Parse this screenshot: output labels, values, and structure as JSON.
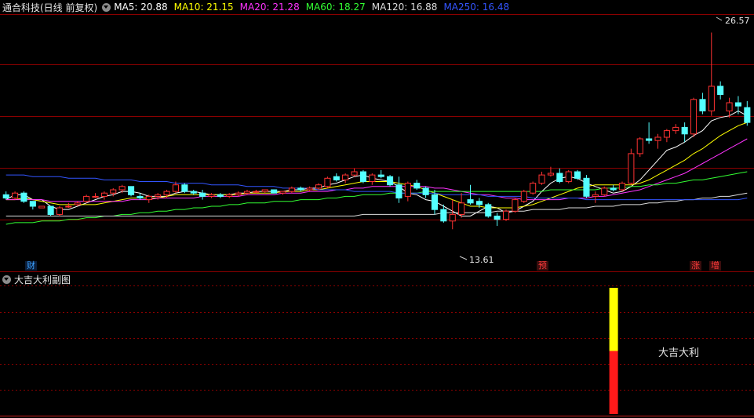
{
  "header": {
    "title": "通合科技(日线 前复权)",
    "ma": [
      {
        "label": "MA5: 20.88",
        "color": "#ffffff"
      },
      {
        "label": "MA10: 21.15",
        "color": "#ffff00"
      },
      {
        "label": "MA20: 21.28",
        "color": "#ff33ff"
      },
      {
        "label": "MA60: 18.27",
        "color": "#33ff33"
      },
      {
        "label": "MA120: 16.88",
        "color": "#dddddd"
      },
      {
        "label": "MA250: 16.48",
        "color": "#3355ff"
      }
    ]
  },
  "main_chart": {
    "high_label": "26.57",
    "low_label": "13.61",
    "markers": [
      {
        "text": "财"
      },
      {
        "text": "预"
      },
      {
        "text": "涨"
      },
      {
        "text": "增"
      }
    ]
  },
  "sub_panel": {
    "title": "大吉大利副图",
    "signal_label": "大吉大利"
  },
  "colors": {
    "up": "#ff3232",
    "down": "#54ffff",
    "grid": "#8b0000"
  },
  "chart_data": {
    "type": "candlestick",
    "ylim": [
      12.8,
      27.5
    ],
    "candles": [
      [
        16.7,
        16.9,
        16.4,
        16.5
      ],
      [
        16.5,
        16.9,
        16.4,
        16.8
      ],
      [
        16.8,
        16.9,
        16.2,
        16.3
      ],
      [
        16.3,
        16.3,
        15.8,
        16.0
      ],
      [
        15.9,
        16.0,
        15.9,
        16.0
      ],
      [
        16.0,
        16.0,
        15.4,
        15.5
      ],
      [
        15.5,
        16.0,
        15.4,
        15.9
      ],
      [
        16.0,
        16.2,
        15.9,
        16.0
      ],
      [
        16.1,
        16.3,
        16.0,
        16.2
      ],
      [
        16.3,
        16.7,
        16.2,
        16.6
      ],
      [
        16.6,
        16.8,
        16.5,
        16.6
      ],
      [
        16.6,
        16.9,
        16.4,
        16.8
      ],
      [
        16.8,
        17.1,
        16.6,
        17.0
      ],
      [
        17.0,
        17.3,
        16.8,
        17.2
      ],
      [
        17.2,
        17.0,
        16.6,
        16.7
      ],
      [
        16.6,
        16.8,
        16.4,
        16.5
      ],
      [
        16.4,
        16.7,
        16.2,
        16.6
      ],
      [
        16.6,
        16.8,
        16.4,
        16.7
      ],
      [
        16.7,
        17.0,
        16.5,
        16.9
      ],
      [
        16.9,
        17.5,
        16.8,
        17.3
      ],
      [
        17.3,
        17.4,
        16.8,
        16.9
      ],
      [
        16.9,
        17.0,
        16.7,
        16.8
      ],
      [
        16.8,
        17.0,
        16.4,
        16.6
      ],
      [
        16.6,
        16.8,
        16.5,
        16.7
      ],
      [
        16.7,
        16.8,
        16.5,
        16.6
      ],
      [
        16.6,
        16.8,
        16.5,
        16.7
      ],
      [
        16.7,
        16.9,
        16.6,
        16.8
      ],
      [
        16.8,
        17.0,
        16.7,
        16.9
      ],
      [
        16.9,
        17.0,
        16.8,
        16.9
      ],
      [
        16.9,
        17.0,
        16.8,
        17.0
      ],
      [
        17.0,
        17.0,
        16.8,
        16.8
      ],
      [
        16.8,
        16.9,
        16.7,
        16.9
      ],
      [
        16.9,
        17.2,
        16.8,
        17.1
      ],
      [
        17.1,
        17.2,
        16.9,
        17.0
      ],
      [
        17.0,
        17.2,
        16.9,
        17.1
      ],
      [
        17.1,
        17.4,
        17.0,
        17.3
      ],
      [
        17.2,
        17.8,
        17.1,
        17.7
      ],
      [
        17.8,
        18.0,
        17.5,
        17.6
      ],
      [
        17.6,
        18.0,
        17.4,
        17.9
      ],
      [
        17.9,
        18.3,
        17.8,
        18.1
      ],
      [
        18.1,
        18.2,
        17.4,
        17.5
      ],
      [
        17.5,
        18.0,
        17.3,
        17.9
      ],
      [
        17.9,
        18.2,
        17.7,
        17.8
      ],
      [
        17.8,
        17.9,
        17.2,
        17.3
      ],
      [
        17.3,
        17.8,
        16.2,
        16.5
      ],
      [
        16.6,
        17.5,
        16.3,
        17.4
      ],
      [
        17.4,
        17.6,
        17.0,
        17.1
      ],
      [
        17.1,
        17.2,
        16.5,
        16.7
      ],
      [
        16.7,
        17.0,
        15.5,
        15.8
      ],
      [
        15.8,
        16.1,
        15.0,
        15.1
      ],
      [
        15.1,
        16.4,
        14.6,
        15.5
      ],
      [
        15.5,
        16.8,
        15.3,
        16.2
      ],
      [
        16.4,
        17.3,
        16.1,
        16.2
      ],
      [
        16.3,
        16.5,
        15.9,
        16.1
      ],
      [
        16.1,
        16.2,
        15.3,
        15.4
      ],
      [
        15.4,
        15.6,
        14.8,
        15.2
      ],
      [
        15.2,
        15.8,
        15.1,
        15.7
      ],
      [
        15.7,
        16.5,
        15.6,
        16.4
      ],
      [
        16.3,
        17.0,
        16.2,
        16.9
      ],
      [
        16.8,
        17.5,
        16.7,
        17.4
      ],
      [
        17.4,
        18.1,
        17.3,
        17.9
      ],
      [
        17.9,
        18.4,
        17.8,
        18.0
      ],
      [
        18.0,
        18.3,
        17.4,
        17.5
      ],
      [
        17.5,
        18.2,
        17.4,
        18.1
      ],
      [
        18.1,
        18.2,
        17.6,
        17.7
      ],
      [
        17.7,
        17.9,
        16.5,
        16.6
      ],
      [
        16.6,
        16.9,
        16.2,
        16.7
      ],
      [
        16.7,
        17.2,
        16.6,
        17.1
      ],
      [
        17.1,
        17.3,
        16.9,
        17.0
      ],
      [
        17.0,
        17.5,
        16.9,
        17.4
      ],
      [
        17.4,
        19.5,
        17.3,
        19.2
      ],
      [
        19.2,
        20.2,
        19.0,
        20.1
      ],
      [
        20.1,
        21.1,
        19.8,
        20.0
      ],
      [
        20.0,
        20.4,
        19.5,
        20.2
      ],
      [
        20.2,
        20.7,
        19.9,
        20.6
      ],
      [
        20.6,
        21.0,
        20.4,
        20.8
      ],
      [
        20.8,
        21.1,
        19.9,
        20.4
      ],
      [
        20.4,
        22.6,
        20.2,
        22.5
      ],
      [
        22.5,
        22.9,
        21.6,
        21.8
      ],
      [
        21.8,
        26.57,
        21.5,
        23.3
      ],
      [
        23.3,
        23.6,
        22.5,
        22.8
      ],
      [
        21.8,
        22.6,
        21.4,
        22.3
      ],
      [
        22.3,
        22.7,
        21.6,
        22.1
      ],
      [
        22.0,
        22.4,
        20.9,
        21.1
      ]
    ],
    "ma_series": [
      {
        "name": "MA5",
        "color": "#ffffff",
        "values": [
          16.4,
          16.7,
          16.7,
          16.4,
          16.4,
          16.0,
          15.8,
          15.8,
          16.0,
          16.2,
          16.4,
          16.6,
          16.7,
          16.9,
          16.9,
          16.8,
          16.6,
          16.6,
          16.6,
          16.8,
          16.9,
          16.9,
          16.8,
          16.7,
          16.7,
          16.7,
          16.8,
          16.8,
          16.9,
          16.9,
          16.9,
          16.9,
          17.0,
          17.0,
          17.1,
          17.1,
          17.3,
          17.4,
          17.6,
          17.8,
          17.9,
          17.7,
          17.6,
          17.5,
          17.2,
          16.8,
          16.7,
          16.4,
          16.3,
          16.0,
          15.7,
          15.4,
          15.4,
          15.7,
          16.0,
          15.9,
          15.6,
          15.7,
          16.0,
          16.3,
          16.9,
          17.4,
          17.7,
          17.8,
          17.7,
          17.4,
          17.2,
          17.0,
          16.8,
          16.9,
          17.2,
          17.6,
          18.2,
          18.8,
          19.4,
          19.6,
          19.9,
          20.3,
          20.6,
          21.2,
          21.4,
          21.5,
          21.8,
          21.5
        ]
      },
      {
        "name": "MA10",
        "color": "#ffff00",
        "values": [
          16.4,
          16.4,
          16.5,
          16.4,
          16.3,
          16.2,
          16.1,
          16.1,
          16.1,
          16.1,
          16.1,
          16.2,
          16.3,
          16.4,
          16.5,
          16.5,
          16.5,
          16.5,
          16.6,
          16.7,
          16.7,
          16.7,
          16.7,
          16.7,
          16.7,
          16.7,
          16.7,
          16.8,
          16.8,
          16.8,
          16.8,
          16.9,
          16.9,
          16.9,
          17.0,
          17.0,
          17.1,
          17.2,
          17.3,
          17.4,
          17.5,
          17.5,
          17.5,
          17.5,
          17.4,
          17.3,
          17.2,
          17.0,
          16.8,
          16.6,
          16.4,
          16.2,
          16.0,
          16.0,
          15.9,
          15.9,
          15.9,
          15.9,
          16.0,
          16.1,
          16.3,
          16.5,
          16.7,
          16.9,
          17.1,
          17.2,
          17.3,
          17.3,
          17.3,
          17.3,
          17.3,
          17.4,
          17.6,
          17.9,
          18.2,
          18.5,
          18.8,
          19.2,
          19.5,
          19.9,
          20.3,
          20.6,
          20.9,
          21.1
        ]
      },
      {
        "name": "MA20",
        "color": "#ff33ff",
        "values": [
          16.4,
          16.4,
          16.4,
          16.4,
          16.4,
          16.3,
          16.3,
          16.3,
          16.3,
          16.3,
          16.3,
          16.3,
          16.3,
          16.3,
          16.4,
          16.4,
          16.4,
          16.5,
          16.5,
          16.5,
          16.5,
          16.5,
          16.6,
          16.6,
          16.6,
          16.6,
          16.6,
          16.7,
          16.7,
          16.7,
          16.7,
          16.8,
          16.8,
          16.8,
          16.9,
          16.9,
          16.9,
          17.0,
          17.0,
          17.1,
          17.1,
          17.2,
          17.2,
          17.2,
          17.2,
          17.2,
          17.2,
          17.2,
          17.1,
          17.1,
          17.0,
          16.9,
          16.8,
          16.7,
          16.7,
          16.6,
          16.5,
          16.5,
          16.4,
          16.4,
          16.4,
          16.4,
          16.4,
          16.5,
          16.5,
          16.5,
          16.6,
          16.6,
          16.7,
          16.8,
          16.9,
          17.0,
          17.2,
          17.4,
          17.6,
          17.8,
          18.0,
          18.3,
          18.6,
          18.9,
          19.2,
          19.5,
          19.8,
          20.1
        ]
      },
      {
        "name": "MA60",
        "color": "#33ff33",
        "values": [
          14.9,
          15.0,
          15.0,
          15.0,
          15.1,
          15.1,
          15.1,
          15.2,
          15.2,
          15.3,
          15.3,
          15.4,
          15.4,
          15.5,
          15.5,
          15.6,
          15.6,
          15.7,
          15.7,
          15.8,
          15.8,
          15.9,
          15.9,
          16.0,
          16.0,
          16.1,
          16.1,
          16.2,
          16.2,
          16.2,
          16.3,
          16.3,
          16.3,
          16.4,
          16.4,
          16.4,
          16.5,
          16.5,
          16.6,
          16.6,
          16.7,
          16.7,
          16.7,
          16.8,
          16.8,
          16.8,
          16.8,
          16.9,
          16.9,
          16.9,
          16.9,
          16.9,
          16.9,
          16.9,
          16.9,
          16.9,
          16.9,
          16.9,
          16.9,
          16.9,
          16.9,
          17.0,
          17.0,
          17.0,
          17.0,
          17.0,
          17.0,
          17.1,
          17.1,
          17.1,
          17.2,
          17.2,
          17.3,
          17.3,
          17.4,
          17.4,
          17.5,
          17.6,
          17.6,
          17.7,
          17.8,
          17.9,
          18.0,
          18.1
        ]
      },
      {
        "name": "MA120",
        "color": "#dddddd",
        "values": [
          15.4,
          15.4,
          15.4,
          15.4,
          15.4,
          15.4,
          15.4,
          15.4,
          15.4,
          15.4,
          15.4,
          15.4,
          15.4,
          15.4,
          15.4,
          15.4,
          15.4,
          15.4,
          15.4,
          15.4,
          15.4,
          15.4,
          15.4,
          15.4,
          15.4,
          15.4,
          15.4,
          15.4,
          15.4,
          15.4,
          15.4,
          15.4,
          15.4,
          15.4,
          15.4,
          15.4,
          15.4,
          15.4,
          15.4,
          15.4,
          15.5,
          15.5,
          15.5,
          15.5,
          15.5,
          15.5,
          15.5,
          15.5,
          15.5,
          15.6,
          15.6,
          15.6,
          15.6,
          15.6,
          15.6,
          15.7,
          15.7,
          15.7,
          15.7,
          15.8,
          15.8,
          15.8,
          15.8,
          15.9,
          15.9,
          15.9,
          16.0,
          16.0,
          16.0,
          16.1,
          16.1,
          16.1,
          16.2,
          16.2,
          16.3,
          16.3,
          16.4,
          16.4,
          16.5,
          16.5,
          16.6,
          16.6,
          16.7,
          16.8
        ]
      },
      {
        "name": "MA250",
        "color": "#3355ff",
        "values": [
          17.9,
          17.9,
          17.9,
          17.8,
          17.8,
          17.8,
          17.8,
          17.7,
          17.7,
          17.7,
          17.7,
          17.6,
          17.6,
          17.6,
          17.6,
          17.5,
          17.5,
          17.5,
          17.5,
          17.4,
          17.4,
          17.4,
          17.4,
          17.3,
          17.3,
          17.3,
          17.3,
          17.2,
          17.2,
          17.2,
          17.2,
          17.1,
          17.1,
          17.1,
          17.1,
          17.0,
          17.0,
          17.0,
          17.0,
          16.9,
          16.9,
          16.9,
          16.9,
          16.9,
          16.8,
          16.8,
          16.8,
          16.8,
          16.8,
          16.7,
          16.7,
          16.7,
          16.7,
          16.7,
          16.6,
          16.6,
          16.6,
          16.6,
          16.6,
          16.5,
          16.5,
          16.5,
          16.5,
          16.5,
          16.5,
          16.4,
          16.4,
          16.4,
          16.4,
          16.4,
          16.4,
          16.4,
          16.4,
          16.4,
          16.4,
          16.4,
          16.4,
          16.4,
          16.4,
          16.4,
          16.4,
          16.4,
          16.4,
          16.5
        ]
      }
    ],
    "signal_bar": {
      "index": 68,
      "total": 1.0,
      "yellow_fraction": 0.5
    }
  }
}
